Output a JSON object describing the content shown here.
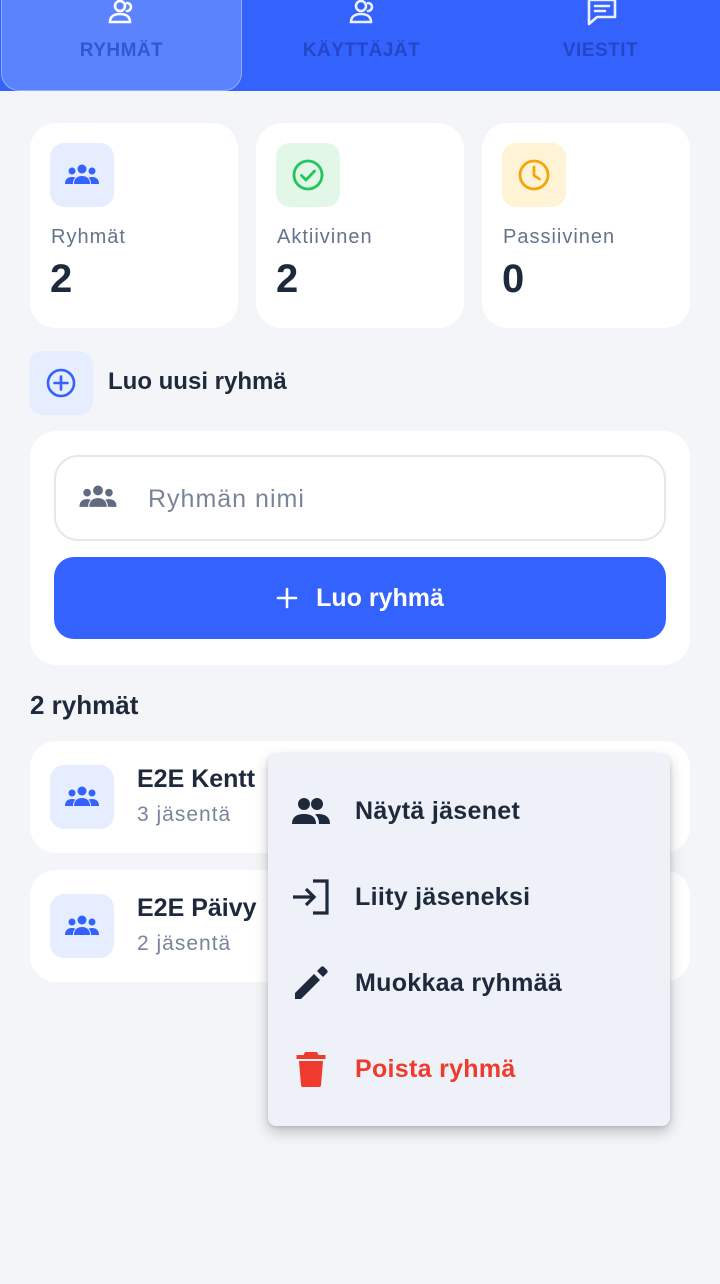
{
  "tabs": [
    {
      "label": "RYHMÄT",
      "icon": "users-icon",
      "active": true
    },
    {
      "label": "KÄYTTÄJÄT",
      "icon": "user-group-icon",
      "active": false
    },
    {
      "label": "VIESTIT",
      "icon": "message-icon",
      "active": false
    }
  ],
  "stats": [
    {
      "label": "Ryhmät",
      "value": "2",
      "icon": "groups-icon",
      "icon_color": "#3462fc",
      "bg": "#e6edff"
    },
    {
      "label": "Aktiivinen",
      "value": "2",
      "icon": "check-circle-icon",
      "icon_color": "#22c55e",
      "bg": "#e3f7e9"
    },
    {
      "label": "Passiivinen",
      "value": "0",
      "icon": "clock-icon",
      "icon_color": "#f5a50b",
      "bg": "#fff3d6"
    }
  ],
  "create": {
    "title": "Luo uusi ryhmä",
    "input_placeholder": "Ryhmän nimi",
    "input_value": "",
    "button_label": "Luo ryhmä"
  },
  "groups": {
    "heading": "2 ryhmät",
    "items": [
      {
        "name": "E2E Kentt",
        "members": "3 jäsentä"
      },
      {
        "name": "E2E Päivy",
        "members": "2 jäsentä"
      }
    ]
  },
  "menu": {
    "items": [
      {
        "label": "Näytä jäsenet",
        "icon": "people-icon"
      },
      {
        "label": "Liity jäseneksi",
        "icon": "login-icon"
      },
      {
        "label": "Muokkaa ryhmää",
        "icon": "pencil-icon"
      },
      {
        "label": "Poista ryhmä",
        "icon": "trash-icon",
        "danger": true
      }
    ]
  },
  "colors": {
    "primary": "#3462fc",
    "danger": "#ef3b2d",
    "background": "#f3f5f9"
  }
}
